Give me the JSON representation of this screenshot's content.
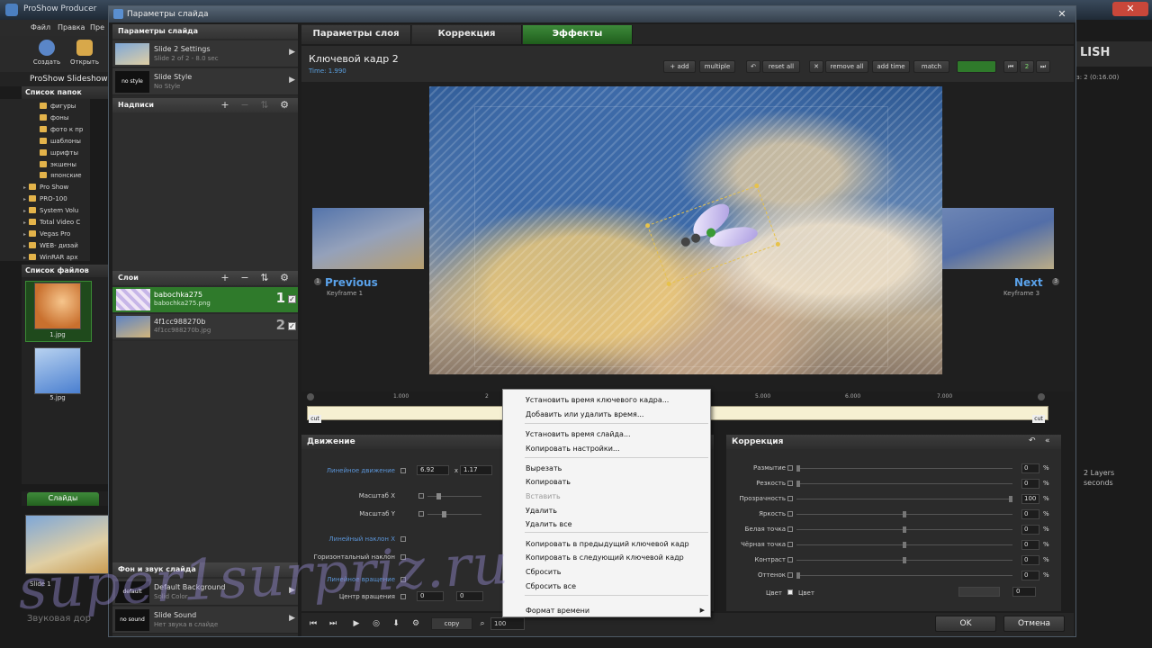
{
  "main_app": {
    "title": "ProShow Producer",
    "menu": [
      "Файл",
      "Правка",
      "Пре"
    ],
    "toolbar": [
      {
        "label": "Создать",
        "icon": "globe-icon"
      },
      {
        "label": "Открыть",
        "icon": "folder-open-icon"
      }
    ],
    "project_title": "ProShow Slideshow",
    "folders_header": "Список папок",
    "folders": [
      {
        "name": "фигуры",
        "level": 2
      },
      {
        "name": "фоны",
        "level": 2
      },
      {
        "name": "фото к пр",
        "level": 2
      },
      {
        "name": "шаблоны",
        "level": 2
      },
      {
        "name": "шрифты",
        "level": 2
      },
      {
        "name": "экшены",
        "level": 2
      },
      {
        "name": "японские",
        "level": 2
      },
      {
        "name": "Pro Show",
        "level": 1
      },
      {
        "name": "PRO-100",
        "level": 1
      },
      {
        "name": "System Volu",
        "level": 1
      },
      {
        "name": "Total Video C",
        "level": 1
      },
      {
        "name": "Vegas Pro",
        "level": 1
      },
      {
        "name": "WEB- дизай",
        "level": 1
      },
      {
        "name": "WinRAR арх",
        "level": 1
      }
    ],
    "files_header": "Список файлов",
    "files": [
      {
        "name": "1.jpg",
        "selected": true
      },
      {
        "name": "5.jpg",
        "selected": false
      }
    ],
    "slides_tab": "Слайды",
    "slide_label": "Slide 1",
    "sound_track_label": "Звуковая дор",
    "publish_label": "LISH",
    "right_info": "з: 2 (0:16.00)",
    "layers_info": [
      "2 Layers",
      "seconds"
    ]
  },
  "dialog": {
    "title": "Параметры слайда",
    "close_symbol": "✕",
    "left": {
      "slide_settings_header": "Параметры слайда",
      "rows": [
        {
          "title": "Slide 2 Settings",
          "sub": "Slide 2 of 2 - 8.0 sec",
          "chev": "▶"
        },
        {
          "title": "Slide Style",
          "sub": "No Style",
          "thumb_text": "no style",
          "chev": "▶"
        }
      ],
      "captions_header": "Надписи",
      "layers_header": "Слои",
      "layers": [
        {
          "name": "babochka275",
          "file": "babochka275.png",
          "num": "1",
          "checked": true,
          "selected": true
        },
        {
          "name": "4f1cc988270b",
          "file": "4f1cc988270b.jpg",
          "num": "2",
          "checked": true,
          "selected": false
        }
      ],
      "bg_sound_header": "Фон и звук слайда",
      "bottom_rows": [
        {
          "title": "Default Background",
          "sub": "Solid Color",
          "thumb_text": "default",
          "chev": "▶"
        },
        {
          "title": "Slide Sound",
          "sub": "Нет звука в слайде",
          "thumb_text": "no sound",
          "chev": "▶"
        }
      ],
      "header_buttons": [
        "+",
        "−",
        "⇅",
        "⚙"
      ]
    },
    "tabs": [
      {
        "label": "Параметры слоя",
        "active": false
      },
      {
        "label": "Коррекция",
        "active": false
      },
      {
        "label": "Эффекты",
        "active": true
      }
    ],
    "keyframe": {
      "title": "Ключевой кадр 2",
      "time": "Time: 1.990",
      "buttons": [
        "+ add",
        "multiple",
        "↶",
        "reset all",
        "✕",
        "remove all",
        "add time",
        "match"
      ]
    },
    "preview": {
      "previous_label": "Previous",
      "previous_sub": "Keyframe 1",
      "next_label": "Next",
      "next_sub": "Keyframe 3",
      "badge_prev": "1",
      "badge_next": "3",
      "badge_current": "2"
    },
    "timeline": {
      "ticks": [
        "1.000",
        "2",
        "5.000",
        "6.000",
        "7.000"
      ],
      "cut_label": "cut"
    },
    "motion": {
      "title": "Движение",
      "labels": {
        "linear_motion": "Линейное движение",
        "pan_x_value": "6.92",
        "x_sep": "x",
        "pan_y_value": "1.17",
        "scale_x": "Масштаб X",
        "scale_y": "Масштаб Y",
        "linear_tilt_x": "Линейный наклон X",
        "horizontal_tilt": "Горизонтальный наклон",
        "linear_rotation": "Линейное вращение",
        "rotation_center": "Центр вращения",
        "rot_x": "0",
        "rot_y": "0"
      }
    },
    "correction": {
      "title": "Коррекция",
      "rows": [
        {
          "label": "Размытие",
          "value": "0",
          "unit": "%",
          "level": 0
        },
        {
          "label": "Резкость",
          "value": "0",
          "unit": "%",
          "level": 0
        },
        {
          "label": "Прозрачность",
          "value": "100",
          "unit": "%",
          "level": 1
        },
        {
          "label": "Яркость",
          "value": "0",
          "unit": "%",
          "level": 0.5
        },
        {
          "label": "Белая точка",
          "value": "0",
          "unit": "%",
          "level": 0.5
        },
        {
          "label": "Чёрная точка",
          "value": "0",
          "unit": "%",
          "level": 0.5
        },
        {
          "label": "Контраст",
          "value": "0",
          "unit": "%",
          "level": 0.5
        },
        {
          "label": "Оттенок",
          "value": "0",
          "unit": "%",
          "level": 0
        }
      ],
      "color_label": "Цвет",
      "color_checkbox_label": "Цвет",
      "color_value": "0"
    },
    "bottom": {
      "copy_label": "copy",
      "zoom_value": "100",
      "ok_label": "OK",
      "cancel_label": "Отмена"
    }
  },
  "context_menu": {
    "items": [
      {
        "label": "Установить время ключевого кадра...",
        "disabled": false
      },
      {
        "label": "Добавить или удалить время...",
        "disabled": false
      },
      {
        "label": "Установить время слайда...",
        "disabled": false
      },
      {
        "label": "Копировать настройки...",
        "disabled": false
      },
      {
        "label": "Вырезать",
        "disabled": false
      },
      {
        "label": "Копировать",
        "disabled": false
      },
      {
        "label": "Вставить",
        "disabled": true
      },
      {
        "label": "Удалить",
        "disabled": false
      },
      {
        "label": "Удалить все",
        "disabled": false
      },
      {
        "label": "Копировать в предыдущий ключевой кадр",
        "disabled": false
      },
      {
        "label": "Копировать в следующий ключевой кадр",
        "disabled": false
      },
      {
        "label": "Сбросить",
        "disabled": false
      },
      {
        "label": "Сбросить все",
        "disabled": false
      },
      {
        "label": "Формат времени",
        "disabled": false,
        "submenu": "▶"
      }
    ]
  },
  "watermark": "super1surpriz.ru",
  "colors": {
    "accent_green": "#2f7a2b",
    "link_blue": "#5aa2ea",
    "cursor_highlight": "#fff028"
  }
}
